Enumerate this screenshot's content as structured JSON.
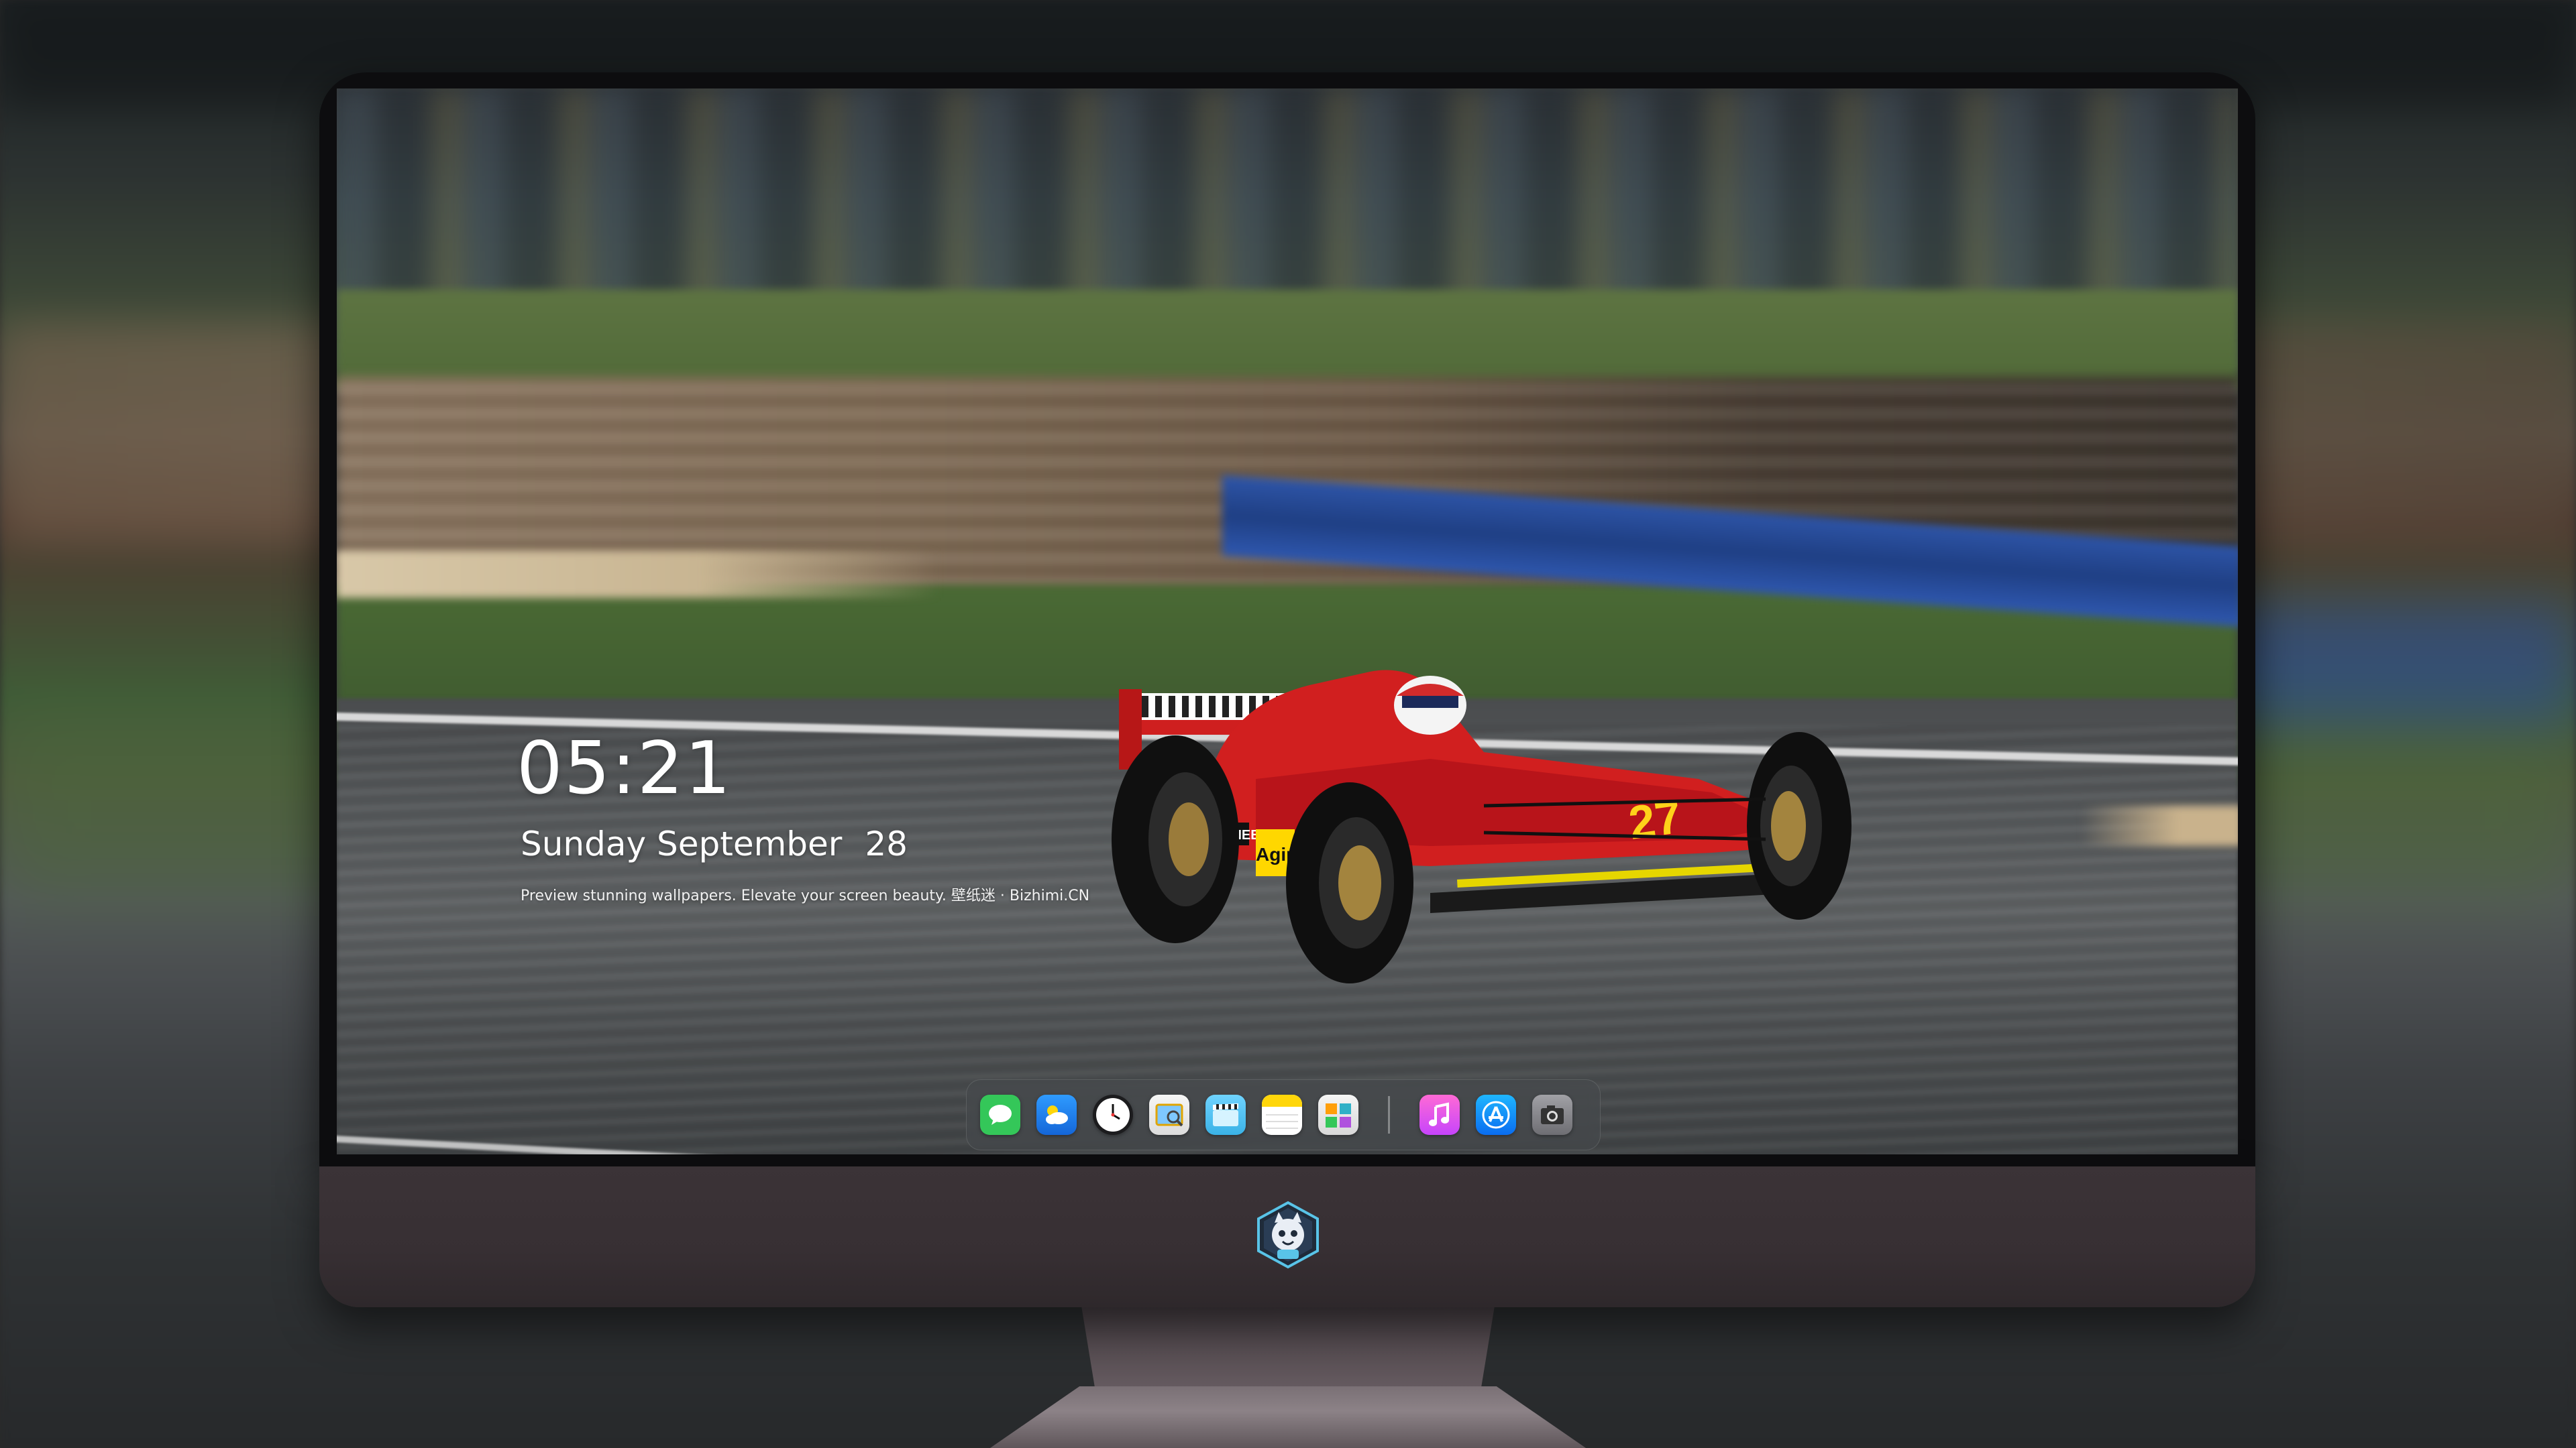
{
  "lockscreen": {
    "time": "05:21",
    "weekday_month": "Sunday September",
    "day": "28",
    "tagline": "Preview stunning wallpapers. Elevate your screen beauty. 壁纸迷 · Bizhimi.CN"
  },
  "wallpaper": {
    "subject": "red formula one race car on track",
    "car_number": "27",
    "sponsor_labels": [
      "PIONEER",
      "Agip"
    ]
  },
  "dock": {
    "apps_left": [
      {
        "name": "messages-icon",
        "color": "#34c759"
      },
      {
        "name": "weather-icon",
        "color": "#1e90ff"
      },
      {
        "name": "clock-icon",
        "color": "#1c1c1e"
      },
      {
        "name": "preview-icon",
        "color": "#f2f2f2"
      },
      {
        "name": "clips-icon",
        "color": "#5ac8fa"
      },
      {
        "name": "notes-icon",
        "color": "#ffd60a"
      },
      {
        "name": "photo-booth-icon",
        "color": "#f2f2f2"
      }
    ],
    "apps_right": [
      {
        "name": "itunes-icon",
        "color": "#ff4fc8"
      },
      {
        "name": "app-store-icon",
        "color": "#1a7cf5"
      },
      {
        "name": "camera-icon",
        "color": "#8e8e93"
      }
    ]
  },
  "colors": {
    "bezel": "#0d0d0f",
    "chin": "#3b3337",
    "stand": "#5a5055",
    "dock_background": "rgba(70,72,76,.55)"
  },
  "chin_logo": "cartoon-mascot-badge"
}
